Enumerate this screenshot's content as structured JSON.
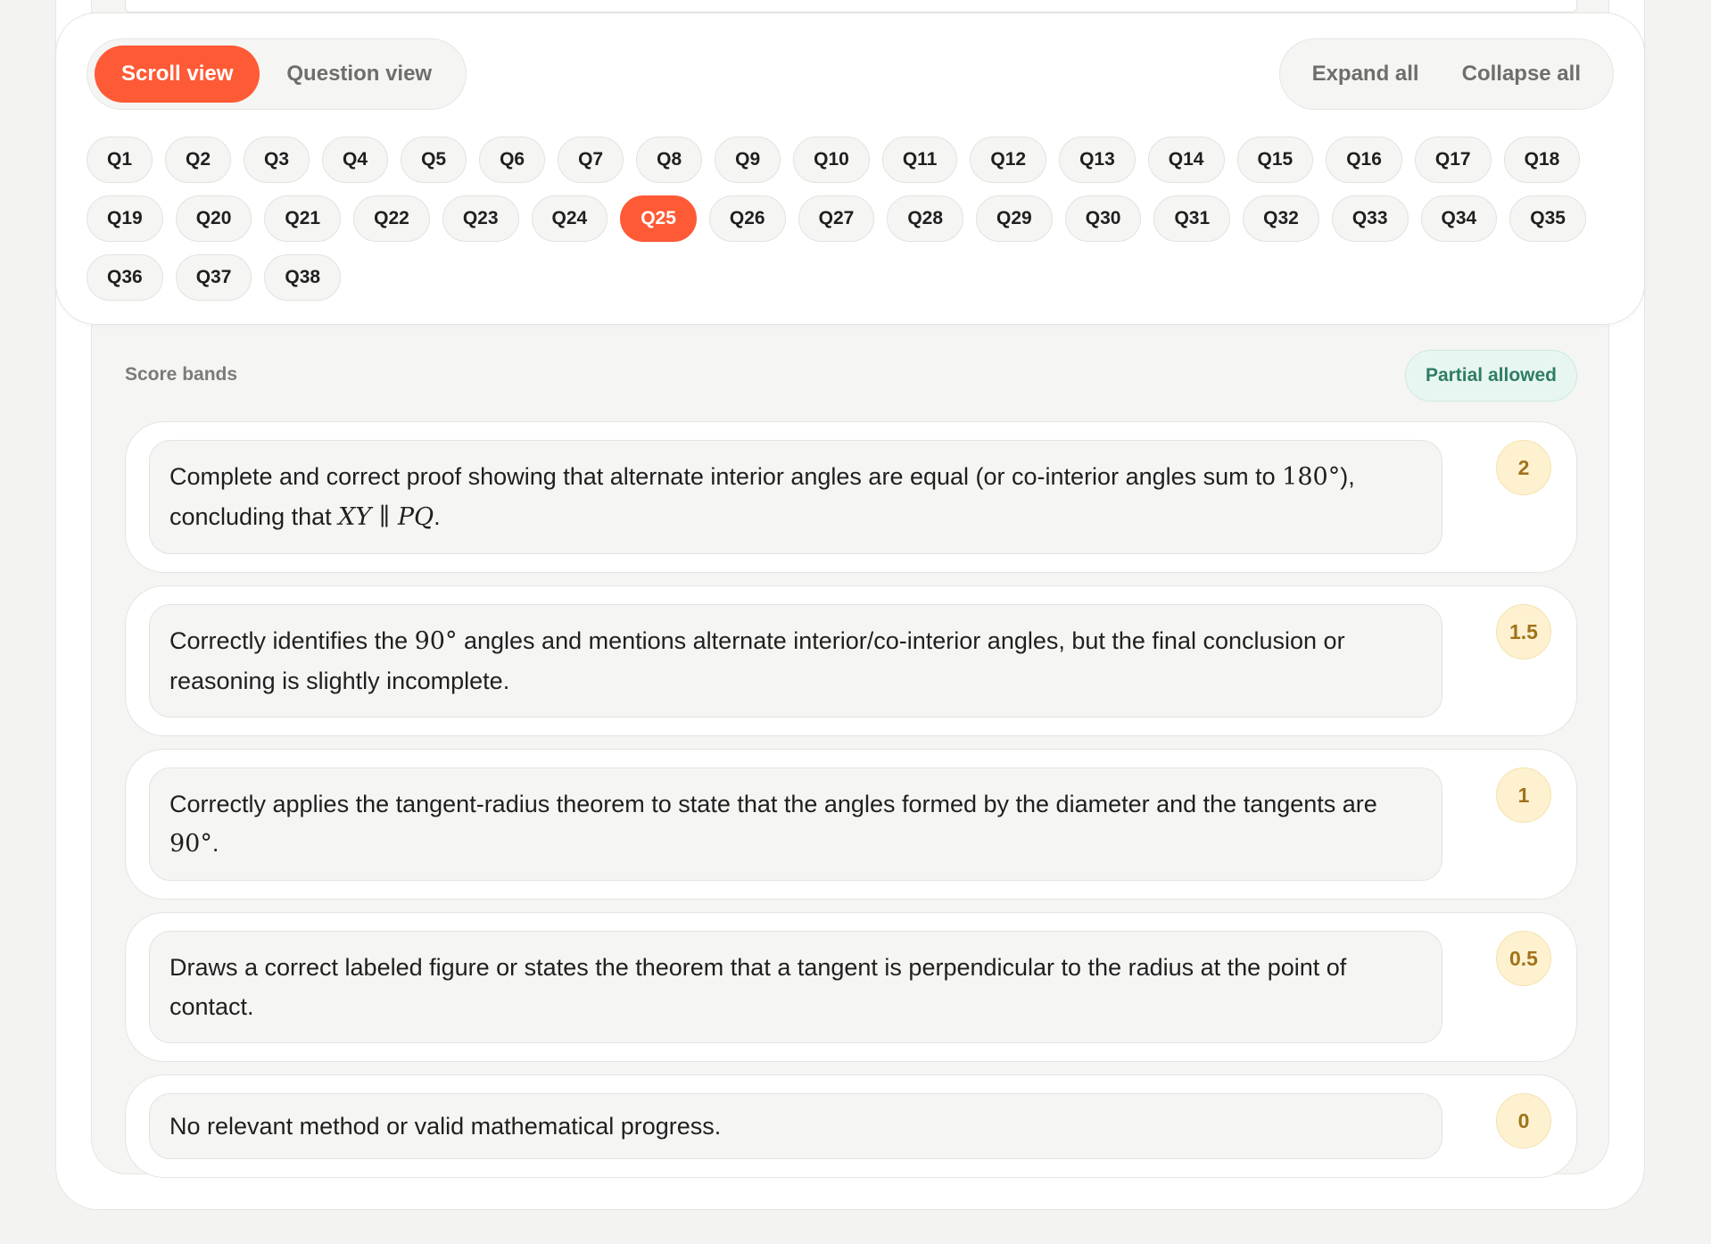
{
  "view_toggle": {
    "scroll_view": "Scroll view",
    "question_view": "Question view"
  },
  "actions": {
    "expand_all": "Expand all",
    "collapse_all": "Collapse all"
  },
  "questions": [
    "Q1",
    "Q2",
    "Q3",
    "Q4",
    "Q5",
    "Q6",
    "Q7",
    "Q8",
    "Q9",
    "Q10",
    "Q11",
    "Q12",
    "Q13",
    "Q14",
    "Q15",
    "Q16",
    "Q17",
    "Q18",
    "Q19",
    "Q20",
    "Q21",
    "Q22",
    "Q23",
    "Q24",
    "Q25",
    "Q26",
    "Q27",
    "Q28",
    "Q29",
    "Q30",
    "Q31",
    "Q32",
    "Q33",
    "Q34",
    "Q35",
    "Q36",
    "Q37",
    "Q38"
  ],
  "active_question": "Q25",
  "score_bands": {
    "label": "Score bands",
    "partial_badge": "Partial allowed",
    "bands": [
      {
        "text_a": "Complete and correct proof showing that alternate interior angles are equal (or co-interior angles sum to ",
        "math_a": "180°",
        "text_b": "), concluding that ",
        "math_b": "XY ∥ PQ",
        "text_c": ".",
        "score": "2"
      },
      {
        "text_a": "Correctly identifies the ",
        "math_a": "90°",
        "text_b": " angles and mentions alternate interior/co-interior angles, but the final conclusion or reasoning is slightly incomplete.",
        "score": "1.5"
      },
      {
        "text_a": "Correctly applies the tangent-radius theorem to state that the angles formed by the diameter and the tangents are ",
        "math_a": "90°",
        "text_b": ".",
        "score": "1"
      },
      {
        "text_a": "Draws a correct labeled figure or states the theorem that a tangent is perpendicular to the radius at the point of contact.",
        "score": "0.5"
      },
      {
        "text_a": "No relevant method or valid mathematical progress.",
        "score": "0"
      }
    ]
  },
  "colors": {
    "accent": "#ff5a36",
    "badge_green_bg": "#e8f6f1",
    "badge_green_text": "#2f7d66",
    "score_bg": "#fdf1cf",
    "score_text": "#a0731a"
  }
}
